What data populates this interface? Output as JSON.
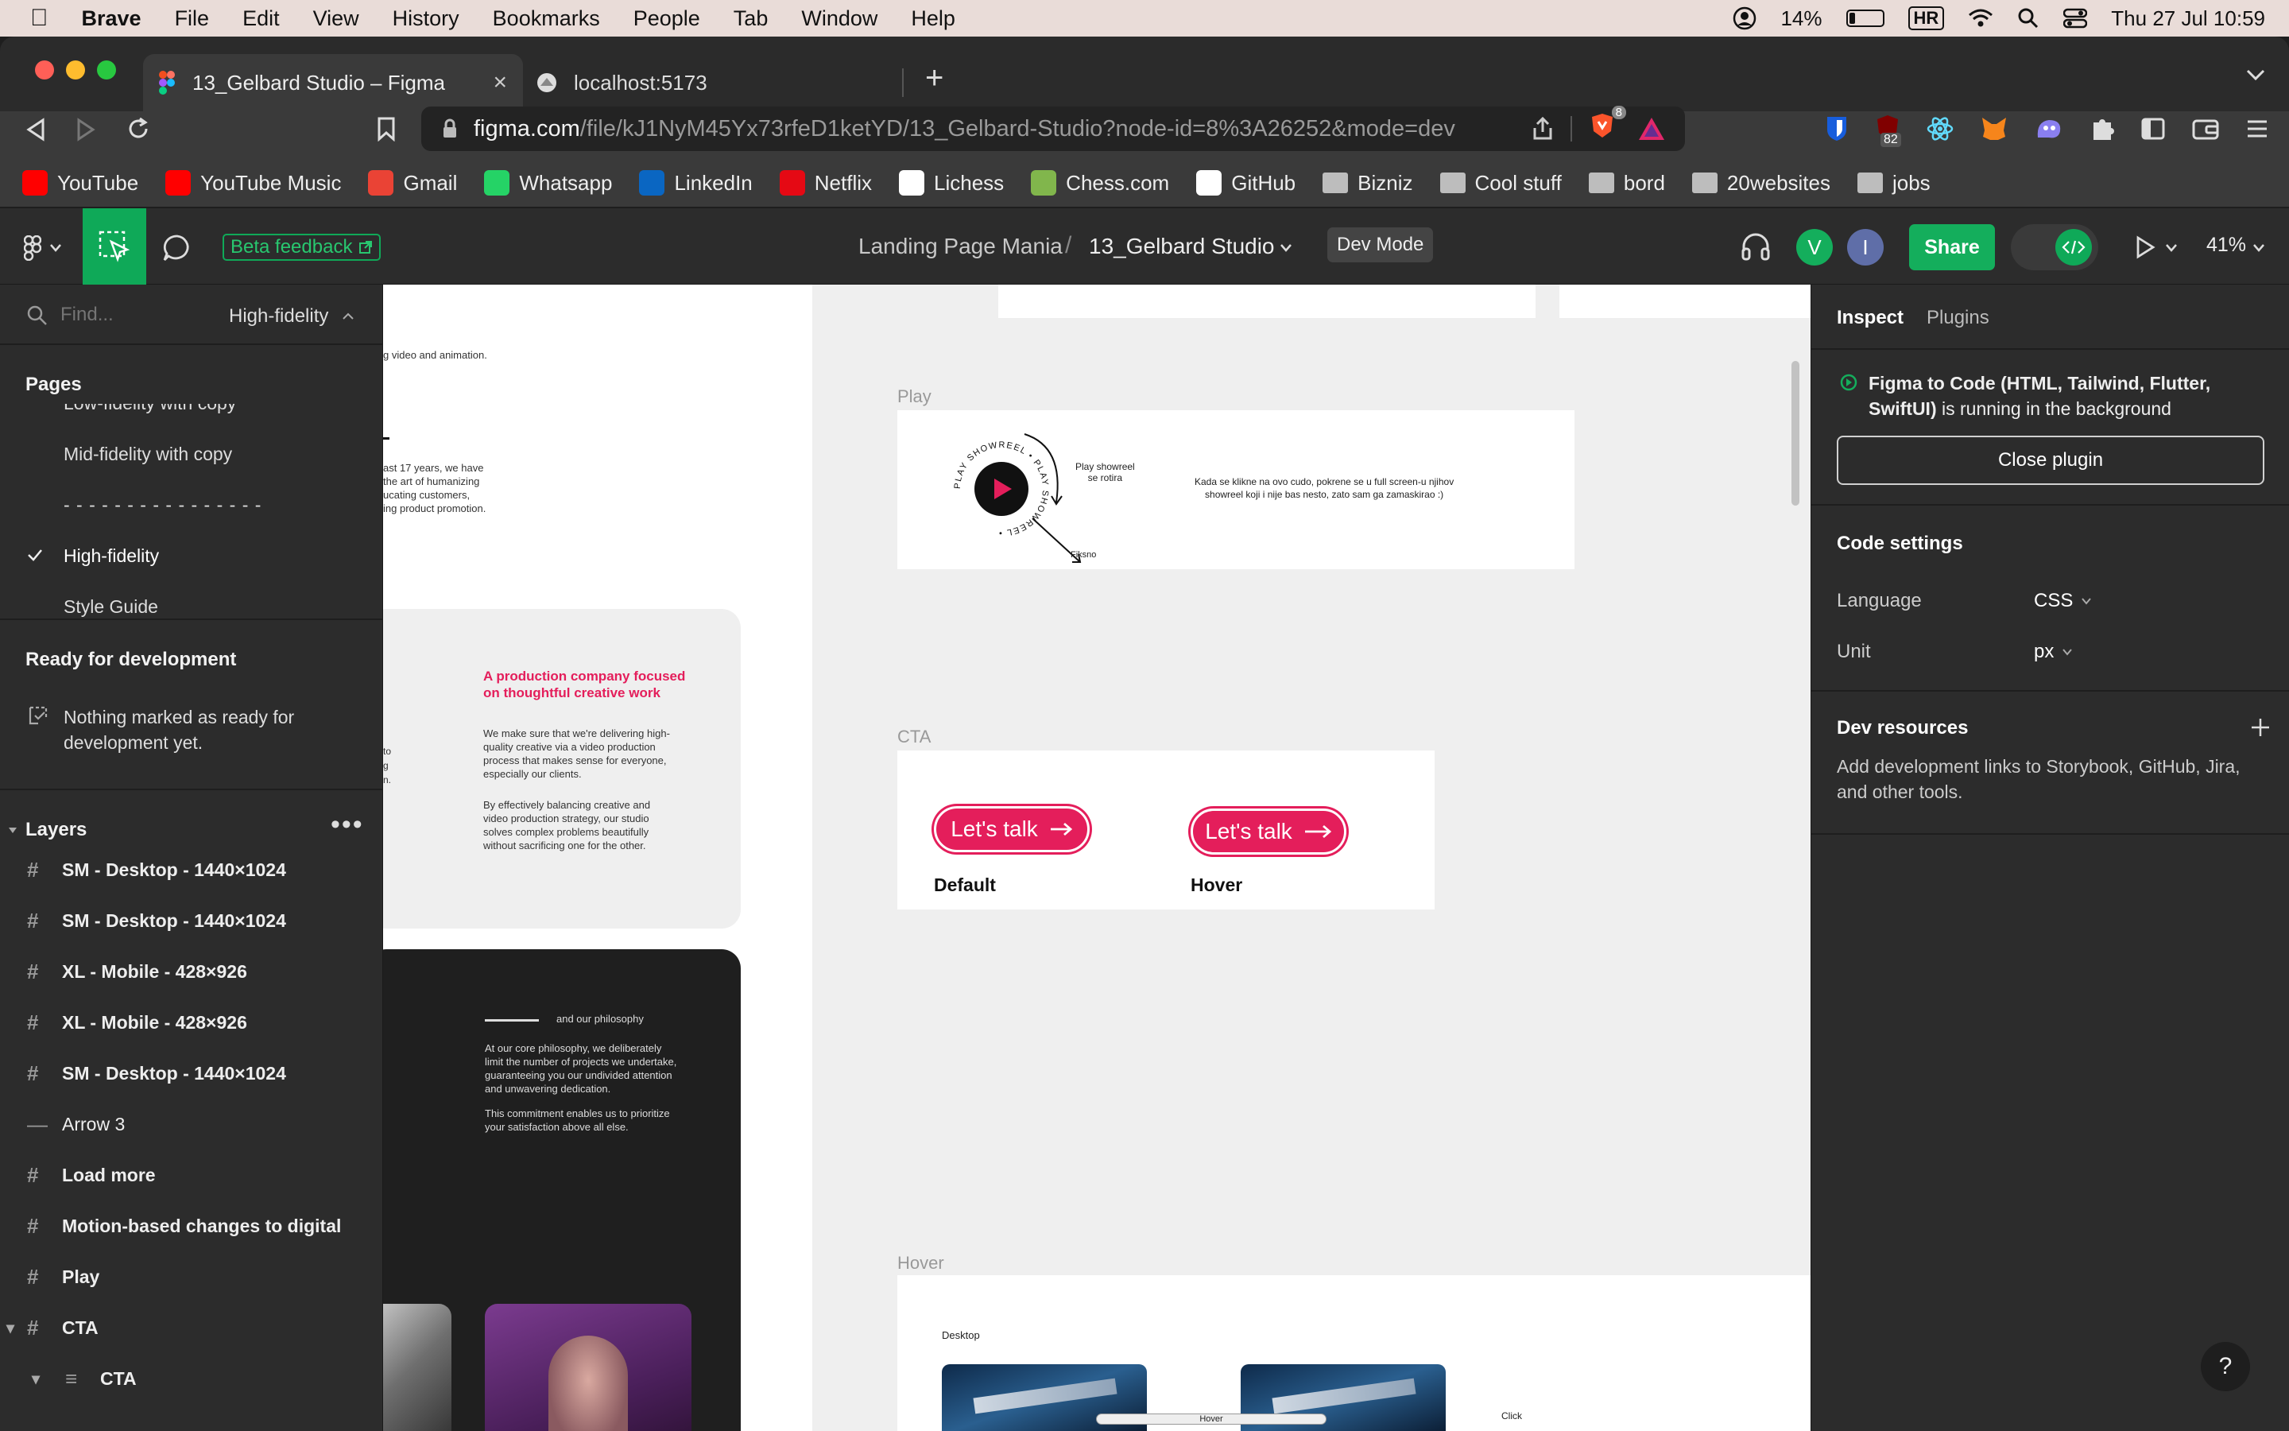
{
  "menubar": {
    "app": "Brave",
    "items": [
      "File",
      "Edit",
      "View",
      "History",
      "Bookmarks",
      "People",
      "Tab",
      "Window",
      "Help"
    ],
    "battery": "14%",
    "input_source": "HR",
    "datetime": "Thu 27 Jul  10:59"
  },
  "tabs": [
    {
      "title": "13_Gelbard Studio – Figma"
    },
    {
      "title": "localhost:5173"
    }
  ],
  "address": {
    "host": "figma.com",
    "path": "/file/kJ1NyM45Yx73rfeD1ketYD/13_Gelbard-Studio?node-id=8%3A26252&mode=dev",
    "brave_count": "8",
    "ext_badge": "82"
  },
  "bookmarks": [
    {
      "label": "YouTube",
      "color": "#ff0000"
    },
    {
      "label": "YouTube Music",
      "color": "#ff0000"
    },
    {
      "label": "Gmail",
      "color": "#ea4335"
    },
    {
      "label": "Whatsapp",
      "color": "#25d366"
    },
    {
      "label": "LinkedIn",
      "color": "#0a66c2"
    },
    {
      "label": "Netflix",
      "color": "#e50914"
    },
    {
      "label": "Lichess",
      "color": "#ffffff"
    },
    {
      "label": "Chess.com",
      "color": "#81b64c"
    },
    {
      "label": "GitHub",
      "color": "#ffffff"
    },
    {
      "label": "Bizniz",
      "folder": true
    },
    {
      "label": "Cool stuff",
      "folder": true
    },
    {
      "label": "bord",
      "folder": true
    },
    {
      "label": "20websites",
      "folder": true
    },
    {
      "label": "jobs",
      "folder": true
    }
  ],
  "figma_toolbar": {
    "beta_feedback": "Beta feedback",
    "project": "Landing Page Mania",
    "separator": "/",
    "file": "13_Gelbard Studio",
    "mode_badge": "Dev Mode",
    "avatar_v": "V",
    "avatar_i": "I",
    "share": "Share",
    "zoom": "41%"
  },
  "left_panel": {
    "find_placeholder": "Find...",
    "current_page": "High-fidelity",
    "pages_heading": "Pages",
    "pages": [
      "Low-fidelity with copy",
      "Mid-fidelity with copy",
      "- - - - - - - - - - - - - - - -",
      "High-fidelity",
      "Style Guide"
    ],
    "ready_heading": "Ready for development",
    "ready_empty": "Nothing marked as ready for development yet.",
    "layers_heading": "Layers",
    "layers": [
      {
        "label": "SM - Desktop - 1440×1024",
        "icon": "frame"
      },
      {
        "label": "SM - Desktop - 1440×1024",
        "icon": "frame"
      },
      {
        "label": "XL - Mobile - 428×926",
        "icon": "frame"
      },
      {
        "label": "XL - Mobile - 428×926",
        "icon": "frame"
      },
      {
        "label": "SM - Desktop - 1440×1024",
        "icon": "frame"
      },
      {
        "label": "Arrow 3",
        "icon": "line"
      },
      {
        "label": "Load more",
        "icon": "frame"
      },
      {
        "label": "Motion-based changes to digital",
        "icon": "frame"
      },
      {
        "label": "Play",
        "icon": "frame"
      },
      {
        "label": "CTA",
        "icon": "frame"
      },
      {
        "label": "CTA",
        "icon": "component"
      }
    ]
  },
  "canvas": {
    "frag_top": "g video and animation.",
    "frag_para": [
      "ast 17 years, we have",
      "the art of humanizing",
      "ucating customers,",
      "ing product promotion."
    ],
    "pink_heading": [
      "A production company focused",
      "on thoughtful creative work"
    ],
    "para1": [
      "We make sure that we're delivering high-",
      "quality creative via a video production",
      "process that makes sense for everyone,",
      "especially our clients."
    ],
    "para2": [
      "By effectively balancing creative and",
      "video production strategy, our studio",
      "solves complex problems beautifully",
      "without sacrificing one for the other."
    ],
    "frag_left": [
      "to",
      "g",
      "n."
    ],
    "philosophy_label": "and our philosophy",
    "philosophy_p1": [
      "At our core philosophy, we deliberately",
      "limit the number of projects we undertake,",
      "guaranteeing you our undivided attention",
      "and unwavering dedication."
    ],
    "philosophy_p2": [
      "This commitment enables us to prioritize",
      "your satisfaction above all else."
    ],
    "play_label": "Play",
    "play_ring_text": "PLAY SHOWREEL • PLAY SHOWREEL •",
    "play_note": [
      "Play showreel",
      "se rotira"
    ],
    "play_fiksno": "Fiksno",
    "play_desc": [
      "Kada se klikne na ovo cudo, pokrene se u full screen-u njihov",
      "showreel koji i nije bas nesto, zato sam ga zamaskirao :)"
    ],
    "cta_label": "CTA",
    "cta_button": "Let's talk",
    "cta_default": "Default",
    "cta_hover": "Hover",
    "hover_label": "Hover",
    "hover_desktop": "Desktop",
    "hover_caption": "Hover",
    "hover_click": "Click"
  },
  "right_panel": {
    "tab_inspect": "Inspect",
    "tab_plugins": "Plugins",
    "plugin_name": "Figma to Code (HTML, Tailwind, Flutter, SwiftUI)",
    "plugin_status": " is running in the background",
    "close_plugin": "Close plugin",
    "code_settings": "Code settings",
    "language_label": "Language",
    "language_value": "CSS",
    "unit_label": "Unit",
    "unit_value": "px",
    "dev_resources": "Dev resources",
    "dev_resources_desc": "Add development links to Storybook, GitHub, Jira, and other tools.",
    "help": "?"
  }
}
